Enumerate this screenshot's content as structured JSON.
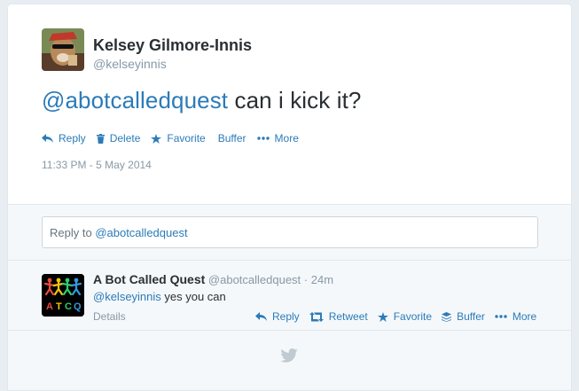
{
  "tweet": {
    "author_name": "Kelsey Gilmore-Innis",
    "author_handle": "@kelseyinnis",
    "text_mention": "@abotcalledquest",
    "text_body": " can i kick it?",
    "actions": {
      "reply": "Reply",
      "delete": "Delete",
      "favorite": "Favorite",
      "buffer": "Buffer",
      "more": "More"
    },
    "timestamp": "11:33 PM - 5 May 2014"
  },
  "reply_box": {
    "prefix": "Reply to ",
    "mention": "@abotcalledquest"
  },
  "reply_tweet": {
    "author_name": "A Bot Called Quest",
    "author_handle": "@abotcalledquest",
    "separator": " · ",
    "time": "24m",
    "text_mention": "@kelseyinnis",
    "text_body": " yes you can",
    "avatar_text": [
      "A",
      "T",
      "C",
      "Q"
    ],
    "details": "Details",
    "actions": {
      "reply": "Reply",
      "retweet": "Retweet",
      "favorite": "Favorite",
      "buffer": "Buffer",
      "more": "More"
    }
  },
  "colors": {
    "link": "#2b7bb9",
    "muted": "#8899a6",
    "text": "#292f33",
    "bird": "#c0cad1"
  },
  "icons": [
    "reply-icon",
    "trash-icon",
    "star-icon",
    "more-dots-icon",
    "retweet-icon",
    "buffer-stack-icon",
    "twitter-bird-icon"
  ]
}
